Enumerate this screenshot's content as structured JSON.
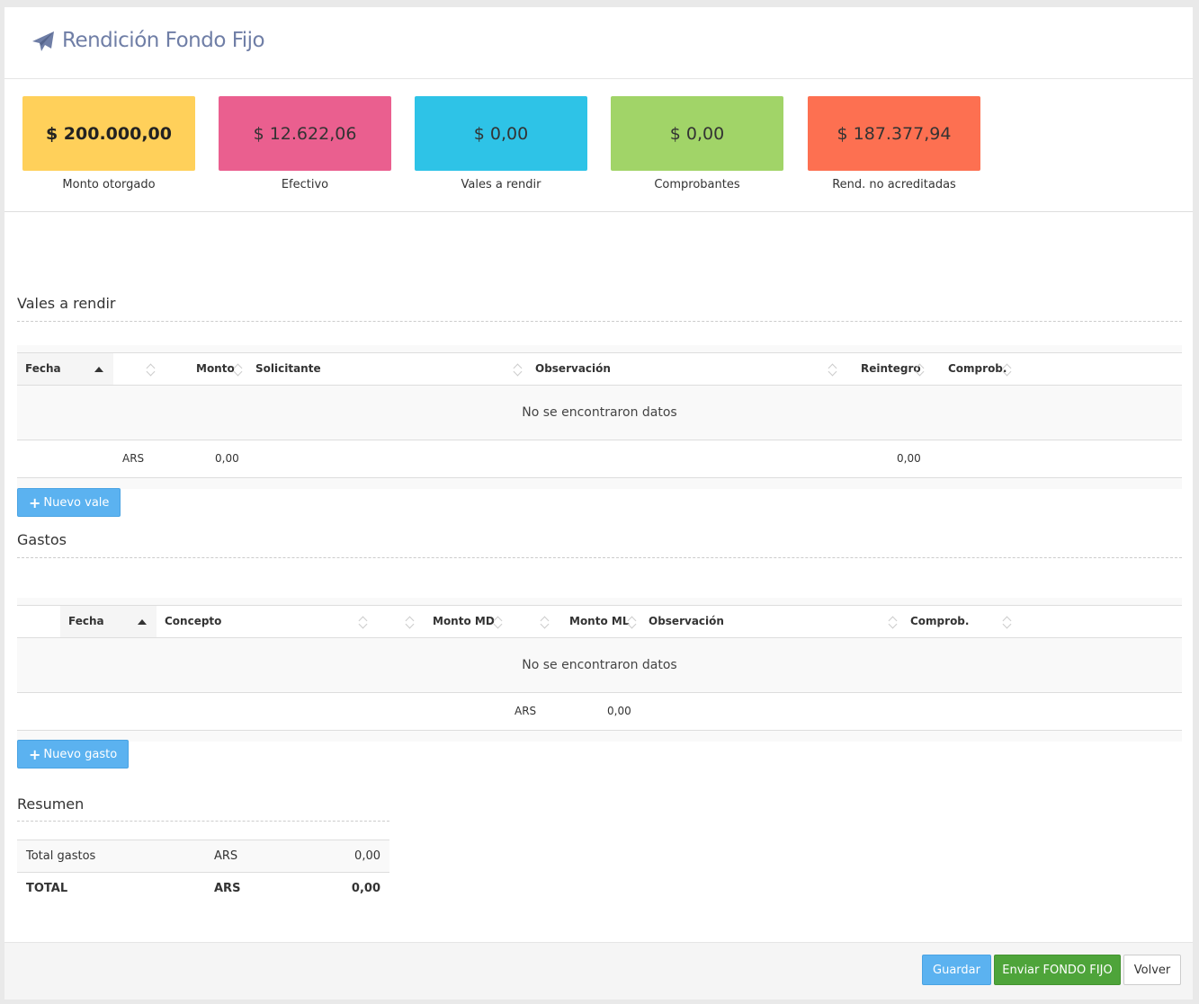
{
  "header": {
    "title": "Rendición Fondo Fijo",
    "icon": "paper-plane-icon"
  },
  "stats": [
    {
      "value": "$ 200.000,00",
      "label": "Monto otorgado",
      "color": "#ffd05a"
    },
    {
      "value": "$ 12.622,06",
      "label": "Efectivo",
      "color": "#ea5f8f"
    },
    {
      "value": "$ 0,00",
      "label": "Vales a rendir",
      "color": "#2ec3e7"
    },
    {
      "value": "$ 0,00",
      "label": "Comprobantes",
      "color": "#a1d468"
    },
    {
      "value": "$ 187.377,94",
      "label": "Rend. no acreditadas",
      "color": "#fd7051"
    }
  ],
  "vales": {
    "title": "Vales a rendir",
    "columns": [
      "Fecha",
      "Monto",
      "Solicitante",
      "Observación",
      "Reintegro",
      "Comprob."
    ],
    "empty": "No se encontraron datos",
    "footer": {
      "currency": "ARS",
      "monto": "0,00",
      "reintegro": "0,00"
    },
    "add_label": "Nuevo vale"
  },
  "gastos": {
    "title": "Gastos",
    "columns": [
      "Fecha",
      "Concepto",
      "Monto MD",
      "Monto ML",
      "Observación",
      "Comprob."
    ],
    "empty": "No se encontraron datos",
    "footer": {
      "currency": "ARS",
      "monto": "0,00"
    },
    "add_label": "Nuevo gasto"
  },
  "resumen": {
    "title": "Resumen",
    "rows": [
      {
        "label": "Total gastos",
        "currency": "ARS",
        "value": "0,00"
      },
      {
        "label": "TOTAL",
        "currency": "ARS",
        "value": "0,00"
      }
    ]
  },
  "actions": {
    "save": "Guardar",
    "send": "Enviar FONDO FIJO",
    "back": "Volver"
  },
  "colors": {
    "primary": "#5bb2f0",
    "success": "#4ea43a",
    "title": "#6f7ea6"
  }
}
